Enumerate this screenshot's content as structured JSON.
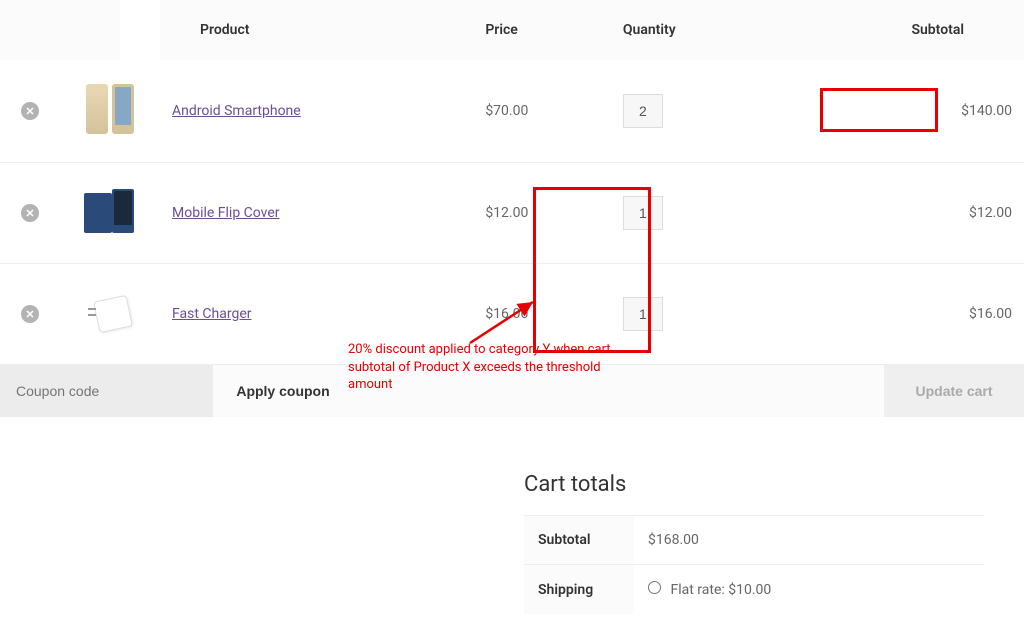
{
  "headers": {
    "product": "Product",
    "price": "Price",
    "quantity": "Quantity",
    "subtotal": "Subtotal"
  },
  "items": [
    {
      "name": "Android Smartphone",
      "price": "$70.00",
      "qty": "2",
      "subtotal": "$140.00"
    },
    {
      "name": "Mobile Flip Cover",
      "price": "$12.00",
      "qty": "1",
      "subtotal": "$12.00"
    },
    {
      "name": "Fast Charger",
      "price": "$16.00",
      "qty": "1",
      "subtotal": "$16.00"
    }
  ],
  "coupon": {
    "placeholder": "Coupon code",
    "apply": "Apply coupon"
  },
  "update_cart": "Update cart",
  "totals": {
    "title": "Cart totals",
    "subtotal_label": "Subtotal",
    "subtotal_value": "$168.00",
    "shipping_label": "Shipping",
    "shipping_option": "Flat rate: $10.00"
  },
  "annotation": "20% discount applied  to category Y when cart subtotal of Product X exceeds the threshold amount"
}
